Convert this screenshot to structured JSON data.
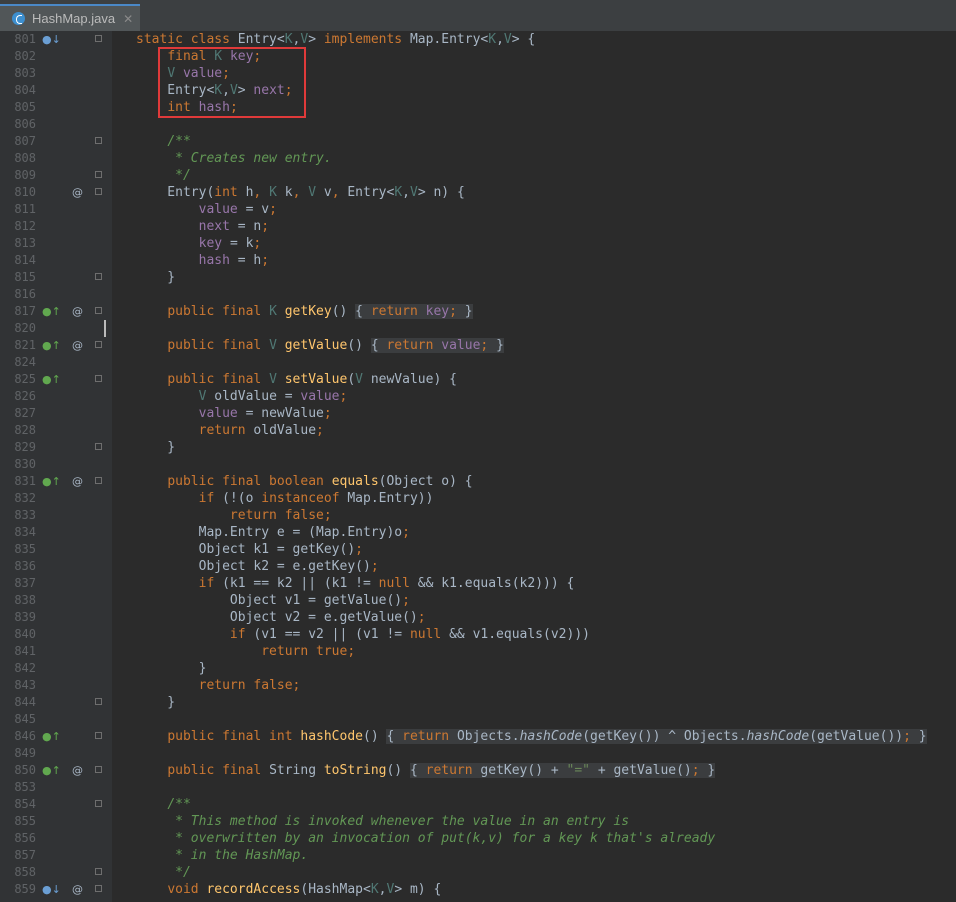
{
  "tab": {
    "label": "HashMap.java",
    "close_icon": "close-icon",
    "file_icon": "java-class-icon"
  },
  "colors": {
    "keyword": "#cc7832",
    "field": "#9876aa",
    "type_param": "#507874",
    "method": "#ffc66d",
    "comment": "#629755",
    "string": "#6a8759",
    "default": "#a9b7c6",
    "highlight_box": "#e03a3a"
  },
  "lines": [
    {
      "n": "801",
      "tokens": [
        {
          "c": "kw",
          "t": "static class "
        },
        {
          "c": "d",
          "t": "Entry<"
        },
        {
          "c": "tp",
          "t": "K"
        },
        {
          "c": "d",
          "t": ","
        },
        {
          "c": "tp",
          "t": "V"
        },
        {
          "c": "d",
          "t": "> "
        },
        {
          "c": "kw",
          "t": "implements "
        },
        {
          "c": "d",
          "t": "Map.Entry<"
        },
        {
          "c": "tp",
          "t": "K"
        },
        {
          "c": "d",
          "t": ","
        },
        {
          "c": "tp",
          "t": "V"
        },
        {
          "c": "d",
          "t": "> {"
        }
      ]
    },
    {
      "n": "802",
      "tokens": [
        {
          "c": "d",
          "t": "    "
        },
        {
          "c": "kw",
          "t": "final "
        },
        {
          "c": "tp",
          "t": "K "
        },
        {
          "c": "fld",
          "t": "key"
        },
        {
          "c": "kw",
          "t": ";"
        }
      ]
    },
    {
      "n": "803",
      "tokens": [
        {
          "c": "d",
          "t": "    "
        },
        {
          "c": "tp",
          "t": "V "
        },
        {
          "c": "fld",
          "t": "value"
        },
        {
          "c": "kw",
          "t": ";"
        }
      ]
    },
    {
      "n": "804",
      "tokens": [
        {
          "c": "d",
          "t": "    Entry<"
        },
        {
          "c": "tp",
          "t": "K"
        },
        {
          "c": "d",
          "t": ","
        },
        {
          "c": "tp",
          "t": "V"
        },
        {
          "c": "d",
          "t": "> "
        },
        {
          "c": "fld",
          "t": "next"
        },
        {
          "c": "kw",
          "t": ";"
        }
      ]
    },
    {
      "n": "805",
      "tokens": [
        {
          "c": "d",
          "t": "    "
        },
        {
          "c": "kw",
          "t": "int "
        },
        {
          "c": "fld",
          "t": "hash"
        },
        {
          "c": "kw",
          "t": ";"
        }
      ]
    },
    {
      "n": "806",
      "tokens": []
    },
    {
      "n": "807",
      "tokens": [
        {
          "c": "d",
          "t": "    "
        },
        {
          "c": "cm",
          "t": "/**"
        }
      ]
    },
    {
      "n": "808",
      "tokens": [
        {
          "c": "d",
          "t": "    "
        },
        {
          "c": "cm",
          "t": " * Creates new entry."
        }
      ]
    },
    {
      "n": "809",
      "tokens": [
        {
          "c": "d",
          "t": "    "
        },
        {
          "c": "cm",
          "t": " */"
        }
      ]
    },
    {
      "n": "810",
      "tokens": [
        {
          "c": "d",
          "t": "    Entry("
        },
        {
          "c": "kw",
          "t": "int "
        },
        {
          "c": "d",
          "t": "h"
        },
        {
          "c": "kw",
          "t": ", "
        },
        {
          "c": "tp",
          "t": "K "
        },
        {
          "c": "d",
          "t": "k"
        },
        {
          "c": "kw",
          "t": ", "
        },
        {
          "c": "tp",
          "t": "V "
        },
        {
          "c": "d",
          "t": "v"
        },
        {
          "c": "kw",
          "t": ", "
        },
        {
          "c": "d",
          "t": "Entry<"
        },
        {
          "c": "tp",
          "t": "K"
        },
        {
          "c": "d",
          "t": ","
        },
        {
          "c": "tp",
          "t": "V"
        },
        {
          "c": "d",
          "t": "> n) {"
        }
      ]
    },
    {
      "n": "811",
      "tokens": [
        {
          "c": "d",
          "t": "        "
        },
        {
          "c": "fld",
          "t": "value "
        },
        {
          "c": "d",
          "t": "= v"
        },
        {
          "c": "kw",
          "t": ";"
        }
      ]
    },
    {
      "n": "812",
      "tokens": [
        {
          "c": "d",
          "t": "        "
        },
        {
          "c": "fld",
          "t": "next "
        },
        {
          "c": "d",
          "t": "= n"
        },
        {
          "c": "kw",
          "t": ";"
        }
      ]
    },
    {
      "n": "813",
      "tokens": [
        {
          "c": "d",
          "t": "        "
        },
        {
          "c": "fld",
          "t": "key "
        },
        {
          "c": "d",
          "t": "= k"
        },
        {
          "c": "kw",
          "t": ";"
        }
      ]
    },
    {
      "n": "814",
      "tokens": [
        {
          "c": "d",
          "t": "        "
        },
        {
          "c": "fld",
          "t": "hash "
        },
        {
          "c": "d",
          "t": "= h"
        },
        {
          "c": "kw",
          "t": ";"
        }
      ]
    },
    {
      "n": "815",
      "tokens": [
        {
          "c": "d",
          "t": "    }"
        }
      ]
    },
    {
      "n": "816",
      "tokens": []
    },
    {
      "n": "817",
      "tokens": [
        {
          "c": "d",
          "t": "    "
        },
        {
          "c": "kw",
          "t": "public final "
        },
        {
          "c": "tp",
          "t": "K "
        },
        {
          "c": "mth",
          "t": "getKey"
        },
        {
          "c": "d",
          "t": "() "
        },
        {
          "c": "fb",
          "t": "{ "
        },
        {
          "c": "kwfb",
          "t": "return "
        },
        {
          "c": "fldfb",
          "t": "key"
        },
        {
          "c": "kwfb",
          "t": "; "
        },
        {
          "c": "fb",
          "t": "}"
        }
      ]
    },
    {
      "n": "820",
      "tokens": []
    },
    {
      "n": "821",
      "tokens": [
        {
          "c": "d",
          "t": "    "
        },
        {
          "c": "kw",
          "t": "public final "
        },
        {
          "c": "tp",
          "t": "V "
        },
        {
          "c": "mth",
          "t": "getValue"
        },
        {
          "c": "d",
          "t": "() "
        },
        {
          "c": "fb",
          "t": "{ "
        },
        {
          "c": "kwfb",
          "t": "return "
        },
        {
          "c": "fldfb",
          "t": "value"
        },
        {
          "c": "kwfb",
          "t": "; "
        },
        {
          "c": "fb",
          "t": "}"
        }
      ]
    },
    {
      "n": "824",
      "tokens": []
    },
    {
      "n": "825",
      "tokens": [
        {
          "c": "d",
          "t": "    "
        },
        {
          "c": "kw",
          "t": "public final "
        },
        {
          "c": "tp",
          "t": "V "
        },
        {
          "c": "mth",
          "t": "setValue"
        },
        {
          "c": "d",
          "t": "("
        },
        {
          "c": "tp",
          "t": "V "
        },
        {
          "c": "d",
          "t": "newValue) {"
        }
      ]
    },
    {
      "n": "826",
      "tokens": [
        {
          "c": "d",
          "t": "        "
        },
        {
          "c": "tp",
          "t": "V "
        },
        {
          "c": "d",
          "t": "oldValue = "
        },
        {
          "c": "fld",
          "t": "value"
        },
        {
          "c": "kw",
          "t": ";"
        }
      ]
    },
    {
      "n": "827",
      "tokens": [
        {
          "c": "d",
          "t": "        "
        },
        {
          "c": "fld",
          "t": "value "
        },
        {
          "c": "d",
          "t": "= newValue"
        },
        {
          "c": "kw",
          "t": ";"
        }
      ]
    },
    {
      "n": "828",
      "tokens": [
        {
          "c": "d",
          "t": "        "
        },
        {
          "c": "kw",
          "t": "return "
        },
        {
          "c": "d",
          "t": "oldValue"
        },
        {
          "c": "kw",
          "t": ";"
        }
      ]
    },
    {
      "n": "829",
      "tokens": [
        {
          "c": "d",
          "t": "    }"
        }
      ]
    },
    {
      "n": "830",
      "tokens": []
    },
    {
      "n": "831",
      "tokens": [
        {
          "c": "d",
          "t": "    "
        },
        {
          "c": "kw",
          "t": "public final boolean "
        },
        {
          "c": "mth",
          "t": "equals"
        },
        {
          "c": "d",
          "t": "(Object o) {"
        }
      ]
    },
    {
      "n": "832",
      "tokens": [
        {
          "c": "d",
          "t": "        "
        },
        {
          "c": "kw",
          "t": "if "
        },
        {
          "c": "d",
          "t": "(!(o "
        },
        {
          "c": "kw",
          "t": "instanceof "
        },
        {
          "c": "d",
          "t": "Map.Entry))"
        }
      ]
    },
    {
      "n": "833",
      "tokens": [
        {
          "c": "d",
          "t": "            "
        },
        {
          "c": "kw",
          "t": "return false;"
        }
      ]
    },
    {
      "n": "834",
      "tokens": [
        {
          "c": "d",
          "t": "        Map.Entry e = (Map.Entry)o"
        },
        {
          "c": "kw",
          "t": ";"
        }
      ]
    },
    {
      "n": "835",
      "tokens": [
        {
          "c": "d",
          "t": "        Object k1 = getKey()"
        },
        {
          "c": "kw",
          "t": ";"
        }
      ]
    },
    {
      "n": "836",
      "tokens": [
        {
          "c": "d",
          "t": "        Object k2 = e.getKey()"
        },
        {
          "c": "kw",
          "t": ";"
        }
      ]
    },
    {
      "n": "837",
      "tokens": [
        {
          "c": "d",
          "t": "        "
        },
        {
          "c": "kw",
          "t": "if "
        },
        {
          "c": "d",
          "t": "(k1 == k2 || (k1 != "
        },
        {
          "c": "kw",
          "t": "null "
        },
        {
          "c": "d",
          "t": "&& k1.equals(k2))) {"
        }
      ]
    },
    {
      "n": "838",
      "tokens": [
        {
          "c": "d",
          "t": "            Object v1 = getValue()"
        },
        {
          "c": "kw",
          "t": ";"
        }
      ]
    },
    {
      "n": "839",
      "tokens": [
        {
          "c": "d",
          "t": "            Object v2 = e.getValue()"
        },
        {
          "c": "kw",
          "t": ";"
        }
      ]
    },
    {
      "n": "840",
      "tokens": [
        {
          "c": "d",
          "t": "            "
        },
        {
          "c": "kw",
          "t": "if "
        },
        {
          "c": "d",
          "t": "(v1 == v2 || (v1 != "
        },
        {
          "c": "kw",
          "t": "null "
        },
        {
          "c": "d",
          "t": "&& v1.equals(v2)))"
        }
      ]
    },
    {
      "n": "841",
      "tokens": [
        {
          "c": "d",
          "t": "                "
        },
        {
          "c": "kw",
          "t": "return true;"
        }
      ]
    },
    {
      "n": "842",
      "tokens": [
        {
          "c": "d",
          "t": "        }"
        }
      ]
    },
    {
      "n": "843",
      "tokens": [
        {
          "c": "d",
          "t": "        "
        },
        {
          "c": "kw",
          "t": "return false;"
        }
      ]
    },
    {
      "n": "844",
      "tokens": [
        {
          "c": "d",
          "t": "    }"
        }
      ]
    },
    {
      "n": "845",
      "tokens": []
    },
    {
      "n": "846",
      "tokens": [
        {
          "c": "d",
          "t": "    "
        },
        {
          "c": "kw",
          "t": "public final int "
        },
        {
          "c": "mth",
          "t": "hashCode"
        },
        {
          "c": "d",
          "t": "() "
        },
        {
          "c": "fb",
          "t": "{ "
        },
        {
          "c": "kwfb",
          "t": "return "
        },
        {
          "c": "fbd",
          "t": "Objects."
        },
        {
          "c": "itfb",
          "t": "hashCode"
        },
        {
          "c": "fbd",
          "t": "(getKey()) ^ Objects."
        },
        {
          "c": "itfb",
          "t": "hashCode"
        },
        {
          "c": "fbd",
          "t": "(getValue())"
        },
        {
          "c": "kwfb",
          "t": "; "
        },
        {
          "c": "fb",
          "t": "}"
        }
      ]
    },
    {
      "n": "849",
      "tokens": []
    },
    {
      "n": "850",
      "tokens": [
        {
          "c": "d",
          "t": "    "
        },
        {
          "c": "kw",
          "t": "public final "
        },
        {
          "c": "d",
          "t": "String "
        },
        {
          "c": "mth",
          "t": "toString"
        },
        {
          "c": "d",
          "t": "() "
        },
        {
          "c": "fb",
          "t": "{ "
        },
        {
          "c": "kwfb",
          "t": "return "
        },
        {
          "c": "fbd",
          "t": "getKey() + "
        },
        {
          "c": "strfb",
          "t": "\"=\""
        },
        {
          "c": "fbd",
          "t": " + getValue()"
        },
        {
          "c": "kwfb",
          "t": "; "
        },
        {
          "c": "fb",
          "t": "}"
        }
      ]
    },
    {
      "n": "853",
      "tokens": []
    },
    {
      "n": "854",
      "tokens": [
        {
          "c": "d",
          "t": "    "
        },
        {
          "c": "cm",
          "t": "/**"
        }
      ]
    },
    {
      "n": "855",
      "tokens": [
        {
          "c": "d",
          "t": "    "
        },
        {
          "c": "cm",
          "t": " * This method is invoked whenever the value in an entry is"
        }
      ]
    },
    {
      "n": "856",
      "tokens": [
        {
          "c": "d",
          "t": "    "
        },
        {
          "c": "cm",
          "t": " * overwritten by an invocation of put(k,v) for a key k that's already"
        }
      ]
    },
    {
      "n": "857",
      "tokens": [
        {
          "c": "d",
          "t": "    "
        },
        {
          "c": "cm",
          "t": " * in the HashMap."
        }
      ]
    },
    {
      "n": "858",
      "tokens": [
        {
          "c": "d",
          "t": "    "
        },
        {
          "c": "cm",
          "t": " */"
        }
      ]
    },
    {
      "n": "859",
      "tokens": [
        {
          "c": "d",
          "t": "    "
        },
        {
          "c": "kw",
          "t": "void "
        },
        {
          "c": "mth",
          "t": "recordAccess"
        },
        {
          "c": "d",
          "t": "(HashMap<"
        },
        {
          "c": "tp",
          "t": "K"
        },
        {
          "c": "d",
          "t": ","
        },
        {
          "c": "tp",
          "t": "V"
        },
        {
          "c": "d",
          "t": "> m) {"
        }
      ]
    }
  ],
  "gutter_marks": {
    "801": {
      "override": "down",
      "fold": true
    },
    "802": {},
    "807": {
      "fold": true
    },
    "809": {
      "fold": true
    },
    "810": {
      "at": true,
      "fold": true
    },
    "815": {
      "fold": true
    },
    "817": {
      "override": "up",
      "at": true,
      "fold": true
    },
    "821": {
      "override": "up",
      "at": true,
      "fold": true
    },
    "825": {
      "override": "up",
      "fold": true
    },
    "829": {
      "fold": true
    },
    "831": {
      "override": "up",
      "at": true,
      "fold": true
    },
    "844": {
      "fold": true
    },
    "846": {
      "override": "up",
      "fold": true
    },
    "850": {
      "override": "up",
      "at": true,
      "fold": true
    },
    "854": {
      "fold": true
    },
    "858": {
      "fold": true
    },
    "859": {
      "override": "down",
      "at": true,
      "fold": true
    }
  },
  "gutter_symbols": {
    "at": "@",
    "up": "●↑",
    "down": "●↓"
  }
}
